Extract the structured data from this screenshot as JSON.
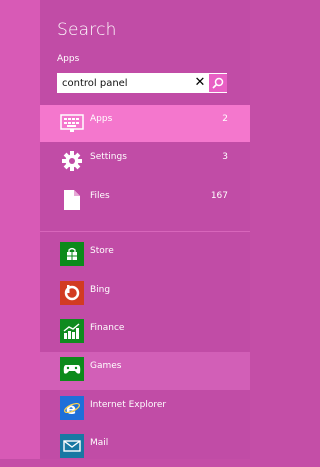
{
  "search": {
    "title": "Search",
    "scope": "Apps",
    "query": "control panel",
    "clear_symbol": "✕"
  },
  "categories": [
    {
      "label": "Apps",
      "count": "2",
      "icon": "apps-keyboard-icon",
      "selected": true
    },
    {
      "label": "Settings",
      "count": "3",
      "icon": "settings-gear-icon",
      "selected": false
    },
    {
      "label": "Files",
      "count": "167",
      "icon": "files-document-icon",
      "selected": false
    }
  ],
  "apps": [
    {
      "label": "Store",
      "icon": "store-icon",
      "color": "#0c8a1b"
    },
    {
      "label": "Bing",
      "icon": "bing-icon",
      "color": "#d23b22"
    },
    {
      "label": "Finance",
      "icon": "finance-icon",
      "color": "#0f8b1f"
    },
    {
      "label": "Games",
      "icon": "games-icon",
      "color": "#0c8a1b"
    },
    {
      "label": "Internet Explorer",
      "icon": "internet-explorer-icon",
      "color": "#1e6fd9"
    },
    {
      "label": "Mail",
      "icon": "mail-icon",
      "color": "#1978a3"
    }
  ],
  "colors": {
    "charm_background": "#c14ca6",
    "selected_row": "#f477cd",
    "accent": "#e85fc4"
  }
}
